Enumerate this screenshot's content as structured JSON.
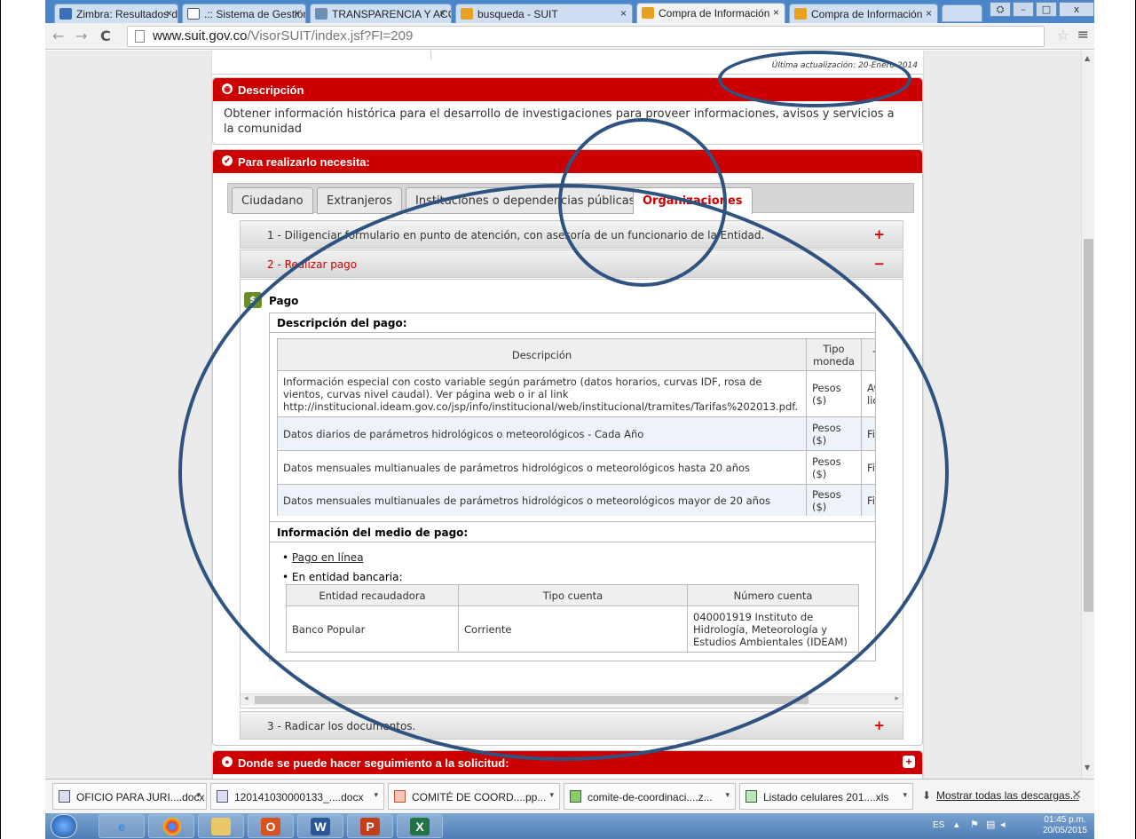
{
  "browser": {
    "tabs": [
      {
        "label": "Zimbra: Resultados de l:",
        "color": "#3b6fb6"
      },
      {
        "label": ".:: Sistema de Gestión D:",
        "color": "#ffffff"
      },
      {
        "label": "TRANSPARENCIA Y ACC",
        "color": "#6d8fb6"
      },
      {
        "label": "busqueda - SUIT",
        "color": "#e8a020"
      },
      {
        "label": "Compra de Información",
        "color": "#e8a020"
      },
      {
        "label": "Compra de Información",
        "color": "#e8a020"
      }
    ],
    "url_host": "www.suit.gov.co",
    "url_path": "/VisorSUIT/index.jsf?FI=209",
    "back": "←",
    "forward": "→",
    "reload": "C",
    "star": "☆",
    "menu": "≡"
  },
  "page": {
    "last_update": "Última actualización: 20-Enero-2014",
    "descripcion_title": "Descripción",
    "descripcion_text": "Obtener información histórica para el desarrollo de investigaciones para proveer informaciones, avisos y servicios a la comunidad",
    "necesita_title": "Para realizarlo necesita:",
    "tabs": [
      "Ciudadano",
      "Extranjeros",
      "Instituciones o dependencias públicas",
      "Organizaciones"
    ],
    "steps": [
      {
        "label": "1 - Diligenciar formulario en punto de atención, con asesoría de un funcionario de la Entidad.",
        "sign": "+"
      },
      {
        "label": "2 - Realizar pago",
        "sign": "−"
      },
      {
        "label": "3 - Radicar los documentos.",
        "sign": "+"
      }
    ],
    "pago_title": "Pago",
    "pago_desc_label": "Descripción del pago:",
    "pago_table_headers": [
      "Descripción",
      "Tipo moneda",
      "Tipo v"
    ],
    "pago_rows": [
      {
        "desc": "Información especial con costo variable según parámetro (datos horarios, curvas IDF, rosa de vientos, curvas nivel caudal). Ver página web o ir al link http://institucional.ideam.gov.co/jsp/info/institucional/web/institucional/tramites/Tarifas%202013.pdf.",
        "moneda": "Pesos ($)",
        "tipo": "Avalúo liquida"
      },
      {
        "desc": "Datos diarios de parámetros hidrológicos o meteorológicos - Cada Año",
        "moneda": "Pesos ($)",
        "tipo": "Fijo"
      },
      {
        "desc": "Datos mensuales multianuales de parámetros hidrológicos o meteorológicos hasta 20 años",
        "moneda": "Pesos ($)",
        "tipo": "Fijo"
      },
      {
        "desc": "Datos mensuales multianuales de parámetros hidrológicos o meteorológicos mayor de 20 años",
        "moneda": "Pesos ($)",
        "tipo": "Fijo"
      }
    ],
    "medio_label": "Información del medio de pago:",
    "pago_linea": "Pago en línea",
    "entidad_bancaria": "En entidad bancaria:",
    "bank_headers": [
      "Entidad recaudadora",
      "Tipo cuenta",
      "Número cuenta"
    ],
    "bank_row": {
      "entidad": "Banco Popular",
      "tipo": "Corriente",
      "numero": "040001919 Instituto de Hidrología, Meteorología y Estudios Ambientales (IDEAM)"
    },
    "seguimiento_title": "Donde se puede hacer seguimiento a la solicitud:"
  },
  "downloads": {
    "items": [
      "OFICIO PARA JURI....docx",
      "120141030000133_....docx",
      "COMITÉ DE COORD....pp...",
      "comite-de-coordinaci....z...",
      "Listado celulares 201....xls"
    ],
    "show_all": "Mostrar todas las descargas...",
    "close": "×"
  },
  "taskbar": {
    "lang": "ES",
    "time": "01:45 p.m.",
    "date": "20/05/2015"
  }
}
